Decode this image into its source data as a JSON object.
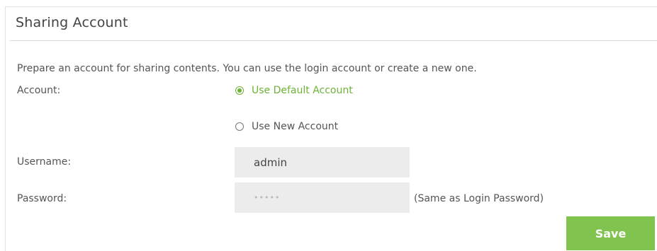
{
  "section": {
    "title": "Sharing Account",
    "description": "Prepare an account for sharing contents. You can use the login account or create a new one."
  },
  "account": {
    "label": "Account:",
    "options": [
      {
        "label": "Use Default Account",
        "selected": true
      },
      {
        "label": "Use New Account",
        "selected": false
      }
    ]
  },
  "username": {
    "label": "Username:",
    "value": "admin"
  },
  "password": {
    "label": "Password:",
    "value": "•••••",
    "hint": "(Same as Login Password)"
  },
  "actions": {
    "save_label": "Save"
  },
  "colors": {
    "accent": "#6cb236",
    "button": "#80c34f",
    "field_background": "#ececec"
  }
}
